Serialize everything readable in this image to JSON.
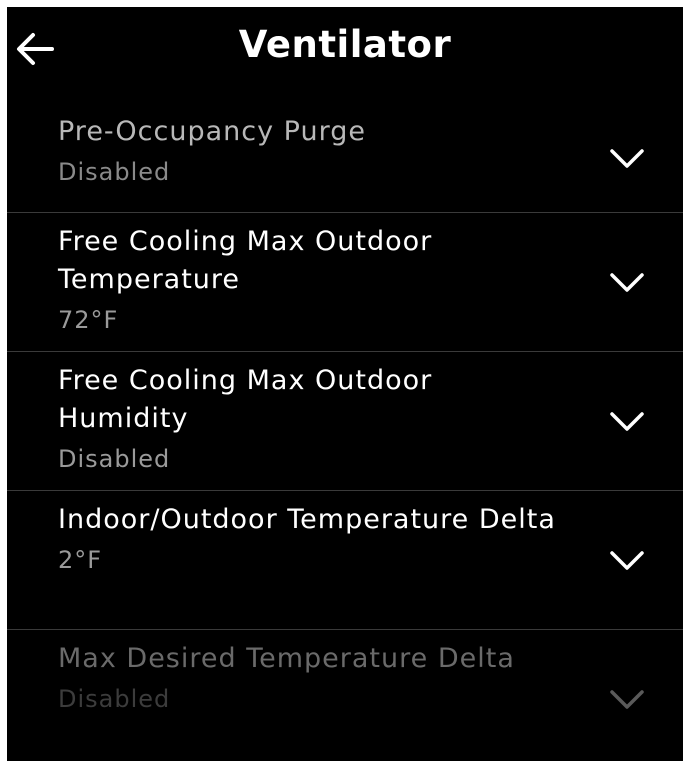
{
  "header": {
    "title": "Ventilator",
    "back_icon": "arrow-left-icon"
  },
  "settings": [
    {
      "label": "Pre-Occupancy Purge",
      "value": "Disabled",
      "icon": "chevron-down-icon"
    },
    {
      "label": "Free Cooling Max Outdoor Temperature",
      "value": "72°F",
      "icon": "chevron-down-icon"
    },
    {
      "label": "Free Cooling Max Outdoor Humidity",
      "value": "Disabled",
      "icon": "chevron-down-icon"
    },
    {
      "label": "Indoor/Outdoor Temperature Delta",
      "value": "2°F",
      "icon": "chevron-down-icon"
    },
    {
      "label": "Max Desired Temperature Delta",
      "value": "Disabled",
      "icon": "chevron-down-icon"
    }
  ],
  "colors": {
    "background": "#000000",
    "text": "#ffffff",
    "secondary_text": "#9a9a9a",
    "divider": "#3a3a3a"
  }
}
